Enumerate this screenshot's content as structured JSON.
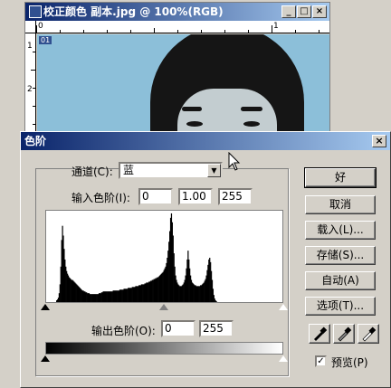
{
  "image_window": {
    "title": "校正颜色 副本.jpg @ 100%(RGB)",
    "layer_label": "01",
    "ruler_top_labels": [
      "0",
      "1"
    ],
    "ruler_left_labels": [
      "1",
      "2"
    ]
  },
  "dialog": {
    "title": "色阶",
    "channel_label": "通道(C):",
    "channel_value": "蓝",
    "input_label": "输入色阶(I):",
    "input_black": "0",
    "input_gamma": "1.00",
    "input_white": "255",
    "output_label": "输出色阶(O):",
    "output_black": "0",
    "output_white": "255",
    "buttons": {
      "ok": "好",
      "cancel": "取消",
      "load": "载入(L)...",
      "save": "存储(S)...",
      "auto": "自动(A)",
      "options": "选项(T)..."
    },
    "preview_label": "预览(P)",
    "preview_checked": true
  },
  "histogram": {
    "channel": "blue",
    "levels": [
      0,
      0,
      0,
      0,
      0,
      0,
      0,
      0,
      0,
      0,
      0,
      0,
      2,
      3,
      5,
      10,
      20,
      40,
      70,
      86,
      75,
      60,
      48,
      40,
      35,
      32,
      30,
      28,
      27,
      26,
      25,
      25,
      24,
      23,
      22,
      21,
      20,
      19,
      18,
      17,
      16,
      15,
      14,
      13,
      13,
      12,
      12,
      11,
      11,
      10,
      10,
      10,
      9,
      9,
      9,
      9,
      9,
      9,
      9,
      9,
      9,
      9,
      9,
      10,
      10,
      10,
      11,
      11,
      12,
      12,
      12,
      12,
      12,
      12,
      12,
      12,
      12,
      12,
      12,
      12,
      13,
      13,
      13,
      13,
      13,
      13,
      13,
      13,
      14,
      14,
      14,
      14,
      14,
      15,
      15,
      15,
      15,
      15,
      16,
      16,
      16,
      16,
      16,
      17,
      17,
      17,
      17,
      18,
      18,
      18,
      18,
      19,
      19,
      19,
      20,
      20,
      20,
      20,
      21,
      21,
      22,
      22,
      22,
      23,
      23,
      24,
      24,
      25,
      25,
      26,
      26,
      27,
      27,
      28,
      28,
      29,
      30,
      31,
      32,
      33,
      34,
      36,
      38,
      40,
      44,
      50,
      58,
      68,
      80,
      95,
      100,
      90,
      75,
      55,
      40,
      30,
      25,
      22,
      20,
      19,
      18,
      18,
      18,
      19,
      20,
      22,
      25,
      30,
      38,
      48,
      58,
      48,
      38,
      30,
      25,
      22,
      21,
      20,
      19,
      19,
      18,
      18,
      18,
      18,
      18,
      19,
      19,
      20,
      21,
      22,
      24,
      26,
      30,
      36,
      42,
      48,
      50,
      45,
      35,
      25,
      15,
      8,
      4,
      2,
      1,
      0,
      0,
      0,
      0,
      0,
      0,
      0,
      0,
      0,
      0,
      0,
      0,
      0,
      0,
      0,
      0,
      0,
      0,
      0,
      0,
      0,
      0,
      0,
      0,
      0,
      0,
      0,
      0,
      0,
      0,
      0,
      0,
      0,
      0,
      0,
      0,
      0,
      0,
      0,
      0,
      0,
      0,
      0,
      0,
      0,
      0,
      0,
      0,
      0,
      0,
      0,
      0,
      0,
      0,
      0,
      0,
      0,
      0,
      0,
      0,
      0,
      0,
      0,
      0,
      0,
      0,
      0,
      0,
      0,
      0,
      0,
      0,
      0,
      0,
      0,
      0,
      0,
      0,
      0
    ]
  }
}
